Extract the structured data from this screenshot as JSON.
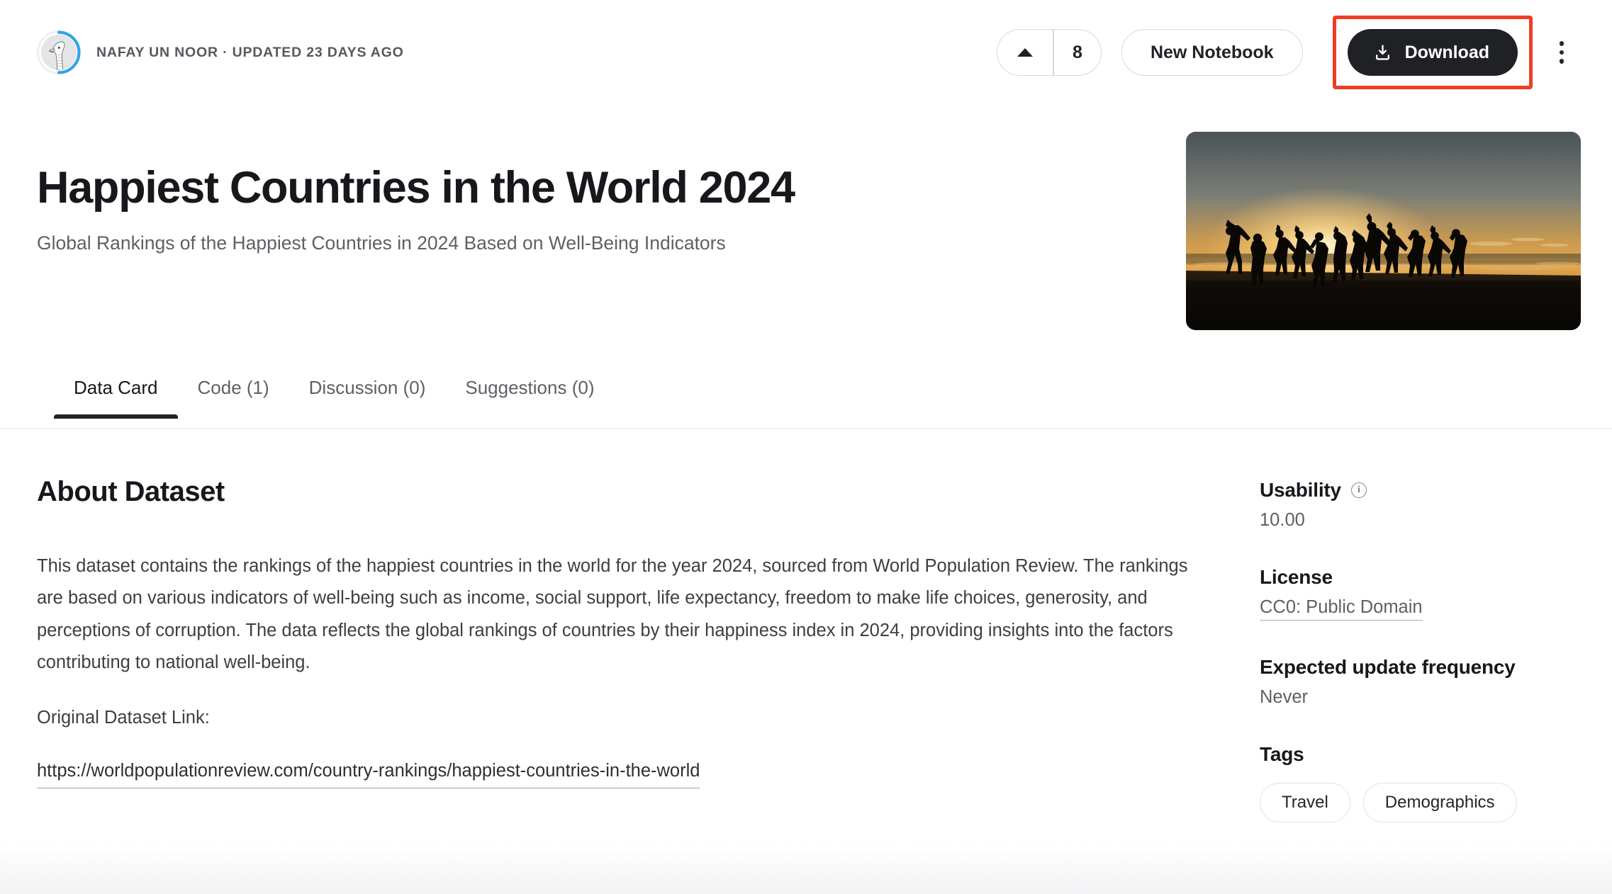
{
  "header": {
    "owner_meta": "NAFAY UN NOOR · UPDATED 23 DAYS AGO",
    "avatar_icon": "goose-avatar-icon",
    "upvote_icon": "caret-up-icon",
    "upvote_count": "8",
    "new_notebook_label": "New Notebook",
    "download_label": "Download",
    "download_icon": "download-icon",
    "more_options_icon": "kebab-menu-icon",
    "highlight_color": "#f03c24"
  },
  "hero": {
    "image_alt": "silhouettes-of-people-jumping-on-beach-at-sunset"
  },
  "title": {
    "heading": "Happiest Countries in the World 2024",
    "subtitle": "Global Rankings of the Happiest Countries in 2024 Based on Well-Being Indicators"
  },
  "tabs": [
    {
      "label": "Data Card",
      "active": true
    },
    {
      "label": "Code (1)",
      "active": false
    },
    {
      "label": "Discussion (0)",
      "active": false
    },
    {
      "label": "Suggestions (0)",
      "active": false
    }
  ],
  "main": {
    "about_heading": "About Dataset",
    "description": "This dataset contains the rankings of the happiest countries in the world for the year 2024, sourced from World Population Review. The rankings are based on various indicators of well-being such as income, social support, life expectancy, freedom to make life choices, generosity, and perceptions of corruption. The data reflects the global rankings of countries by their happiness index in 2024, providing insights into the factors contributing to national well-being.",
    "original_link_label": "Original Dataset Link:",
    "original_link_url": "https://worldpopulationreview.com/country-rankings/happiest-countries-in-the-world"
  },
  "sidebar": {
    "usability_label": "Usability",
    "usability_info_icon": "info-icon",
    "usability_value": "10.00",
    "license_label": "License",
    "license_value": "CC0: Public Domain",
    "update_frequency_label": "Expected update frequency",
    "update_frequency_value": "Never",
    "tags_label": "Tags",
    "tags": [
      "Travel",
      "Demographics"
    ]
  }
}
